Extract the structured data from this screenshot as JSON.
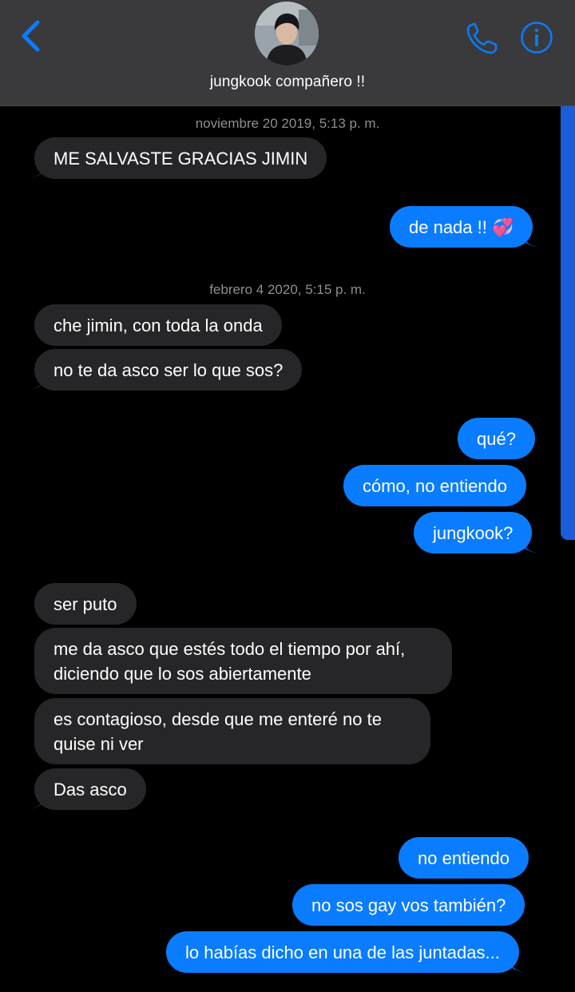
{
  "header": {
    "contact_name": "jungkook compañero !!",
    "back_icon": "chevron-left-icon",
    "call_icon": "phone-icon",
    "info_icon": "info-icon",
    "accent_color": "#0a7cff"
  },
  "conversation": {
    "timestamps": [
      "noviembre 20 2019, 5:13 p. m.",
      "febrero 4 2020, 5:15 p. m."
    ],
    "messages": [
      {
        "direction": "in",
        "text": "ME SALVASTE GRACIAS JIMIN"
      },
      {
        "direction": "out",
        "text": "de nada !! 💞"
      },
      {
        "direction": "in",
        "text": "che jimin, con toda la onda"
      },
      {
        "direction": "in",
        "text": "no te da asco ser lo que sos?"
      },
      {
        "direction": "out",
        "text": "qué?"
      },
      {
        "direction": "out",
        "text": "cómo, no entiendo"
      },
      {
        "direction": "out",
        "text": "jungkook?"
      },
      {
        "direction": "in",
        "text": "ser puto"
      },
      {
        "direction": "in",
        "text": "me da asco que estés todo el tiempo por ahí, diciendo que lo sos abiertamente"
      },
      {
        "direction": "in",
        "text": "es contagioso, desde que me enteré no te quise ni ver"
      },
      {
        "direction": "in",
        "text": "Das asco"
      },
      {
        "direction": "out",
        "text": "no entiendo"
      },
      {
        "direction": "out",
        "text": "no sos gay vos también?"
      },
      {
        "direction": "out",
        "text": "lo habías dicho en una de las juntadas..."
      }
    ]
  },
  "colors": {
    "incoming_bubble": "#262628",
    "outgoing_bubble": "#0a7cff",
    "header_bg": "#3a3a3c",
    "timestamp_text": "#8e8e93"
  }
}
